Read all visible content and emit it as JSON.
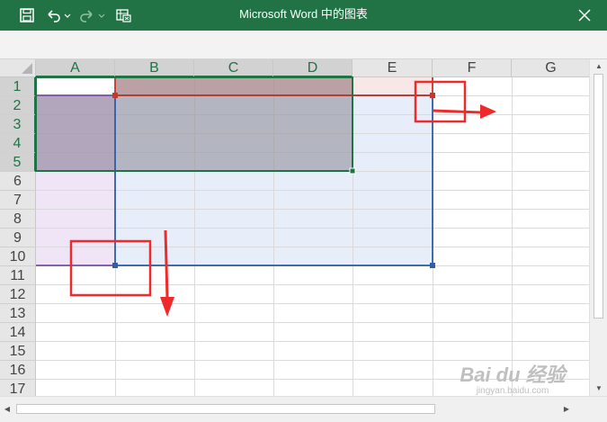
{
  "window": {
    "title": "Microsoft Word 中的图表",
    "background_color": "#217346"
  },
  "grid": {
    "columns": [
      "A",
      "B",
      "C",
      "D",
      "E",
      "F",
      "G"
    ],
    "rows": [
      "1",
      "2",
      "3",
      "4",
      "5",
      "6",
      "7",
      "8",
      "9",
      "10",
      "11",
      "12",
      "13",
      "14",
      "15",
      "16",
      "17"
    ],
    "selected_columns": [
      "A",
      "B",
      "C",
      "D"
    ],
    "selected_rows": [
      "1",
      "2",
      "3",
      "4",
      "5"
    ]
  },
  "colors": {
    "selection_green": "#217346",
    "series_red": "#c0392b",
    "value_blue": "#2e5ea8",
    "category_purple": "#7a4ea3",
    "annotation_red": "#ee2a2a"
  },
  "watermark": {
    "main": "Bai du 经验",
    "sub": "jingyan.baidu.com"
  }
}
